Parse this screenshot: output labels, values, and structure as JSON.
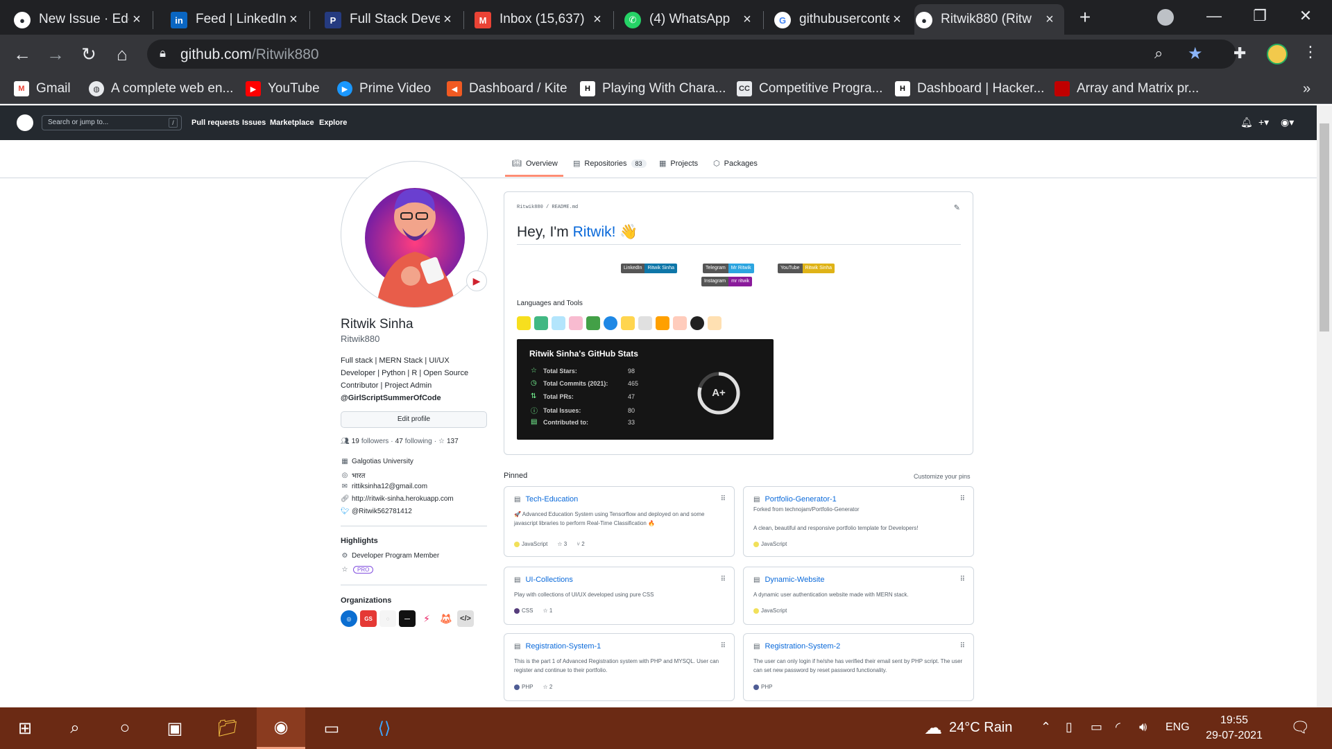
{
  "browser": {
    "tabs": [
      {
        "title": "New Issue · Edc",
        "icon": "github-icon",
        "active": false
      },
      {
        "title": "Feed | LinkedIn",
        "icon": "linkedin-icon",
        "active": false
      },
      {
        "title": "Full Stack Deve",
        "icon": "paypal-icon",
        "active": false
      },
      {
        "title": "Inbox (15,637)",
        "icon": "gmail-icon",
        "active": false
      },
      {
        "title": "(4) WhatsApp",
        "icon": "whatsapp-icon",
        "active": false
      },
      {
        "title": "githubuserconte",
        "icon": "google-icon",
        "active": false
      },
      {
        "title": "Ritwik880 (Ritw",
        "icon": "github-icon",
        "active": true
      }
    ],
    "url_host": "github.com",
    "url_path": "/Ritwik880",
    "bookmarks": [
      {
        "label": "Gmail",
        "icon": "gmail-icon",
        "color": "#ea4335"
      },
      {
        "label": "A complete web en...",
        "icon": "globe-icon",
        "color": "#e8eaed"
      },
      {
        "label": "YouTube",
        "icon": "youtube-icon",
        "color": "#ff0000"
      },
      {
        "label": "Prime Video",
        "icon": "prime-video-icon",
        "color": "#1a98ff"
      },
      {
        "label": "Dashboard / Kite",
        "icon": "kite-icon",
        "color": "#f15a22"
      },
      {
        "label": "Playing With Chara...",
        "icon": "hackerrank-icon",
        "color": "#1ba94c"
      },
      {
        "label": "Competitive Progra...",
        "icon": "codechef-icon",
        "color": "#8a6d3b"
      },
      {
        "label": "Dashboard | Hacker...",
        "icon": "hackerrank-icon",
        "color": "#1ba94c"
      },
      {
        "label": "Array and Matrix pr...",
        "icon": "bookmark-icon",
        "color": "#c00000"
      }
    ]
  },
  "github": {
    "search_placeholder": "Search or jump to...",
    "search_key": "/",
    "nav": [
      "Pull requests",
      "Issues",
      "Marketplace",
      "Explore"
    ],
    "profile_tabs": [
      {
        "label": "Overview",
        "icon": "book-icon"
      },
      {
        "label": "Repositories",
        "icon": "repo-icon",
        "count": "83"
      },
      {
        "label": "Projects",
        "icon": "project-icon"
      },
      {
        "label": "Packages",
        "icon": "package-icon"
      }
    ],
    "profile": {
      "name": "Ritwik Sinha",
      "login": "Ritwik880",
      "bio_lines": [
        "Full stack | MERN Stack | UI/UX",
        "Developer | Python | R | Open Source",
        "Contributor | Project Admin",
        "@GirlScriptSummerOfCode"
      ],
      "edit_label": "Edit profile",
      "followers": "19",
      "followers_label": "followers",
      "following": "47",
      "following_label": "following",
      "stars": "137",
      "vcard": [
        {
          "icon": "organization-icon",
          "text": "Galgotias University"
        },
        {
          "icon": "location-icon",
          "text": "भारत"
        },
        {
          "icon": "mail-icon",
          "text": "rittiksinha12@gmail.com"
        },
        {
          "icon": "link-icon",
          "text": "http://ritwik-sinha.herokuapp.com"
        },
        {
          "icon": "twitter-icon",
          "text": "@Ritwik562781412"
        }
      ],
      "highlights_title": "Highlights",
      "highlight_item": "Developer Program Member",
      "pro_badge": "PRO",
      "organizations_title": "Organizations"
    },
    "readme": {
      "path": "Ritwik880 / README.md",
      "title_prefix": "Hey, I'm ",
      "title_name": "Ritwik!",
      "title_emoji": "👋",
      "badges": [
        {
          "left": "LinkedIn",
          "right": "Ritwik Sinha",
          "left_color": "#555555",
          "right_color": "#0e76a8"
        },
        {
          "left": "Telegram",
          "right": "Mr Ritwik",
          "left_color": "#555555",
          "right_color": "#2ca5e0"
        },
        {
          "left": "YouTube",
          "right": "Ritwik Sinha",
          "left_color": "#555555",
          "right_color": "#dfb317"
        },
        {
          "left": "Instagram",
          "right": "mr ritwik",
          "left_color": "#555555",
          "right_color": "#8a1a9b"
        }
      ],
      "languages_label": "Languages and Tools",
      "stats": {
        "title": "Ritwik Sinha's GitHub Stats",
        "rows": [
          {
            "label": "Total Stars:",
            "value": "98"
          },
          {
            "label": "Total Commits (2021):",
            "value": "465"
          },
          {
            "label": "Total PRs:",
            "value": "47"
          },
          {
            "label": "Total Issues:",
            "value": "80"
          },
          {
            "label": "Contributed to:",
            "value": "33"
          }
        ],
        "grade": "A+"
      }
    },
    "pinned_label": "Pinned",
    "customize_label": "Customize your pins",
    "pinned": [
      {
        "name": "Tech-Education",
        "fork": "",
        "desc": "🚀 Advanced Education System using Tensorflow and deployed on and some javascript libraries to perform Real-Time Classification 🔥",
        "lang": "JavaScript",
        "lang_color": "#f1e05a",
        "stars": "3",
        "forks": "2"
      },
      {
        "name": "Portfolio-Generator-1",
        "fork": "Forked from technojam/Portfolio-Generator",
        "desc": "A clean, beautiful and responsive portfolio template for Developers!",
        "lang": "JavaScript",
        "lang_color": "#f1e05a",
        "stars": "",
        "forks": ""
      },
      {
        "name": "UI-Collections",
        "fork": "",
        "desc": "Play with collections of UI/UX developed using pure CSS",
        "lang": "CSS",
        "lang_color": "#563d7c",
        "stars": "1",
        "forks": ""
      },
      {
        "name": "Dynamic-Website",
        "fork": "",
        "desc": "A dynamic user authentication website made with MERN stack.",
        "lang": "JavaScript",
        "lang_color": "#f1e05a",
        "stars": "",
        "forks": ""
      },
      {
        "name": "Registration-System-1",
        "fork": "",
        "desc": "This is the part 1 of Advanced Registration system with PHP and MYSQL. User can register and continue to their portfolio.",
        "lang": "PHP",
        "lang_color": "#4F5D95",
        "stars": "2",
        "forks": ""
      },
      {
        "name": "Registration-System-2",
        "fork": "",
        "desc": "The user can only login if he/she has verified their email sent by PHP script. The user can set new password by reset password functionality.",
        "lang": "PHP",
        "lang_color": "#4F5D95",
        "stars": "",
        "forks": ""
      }
    ]
  },
  "taskbar": {
    "weather": "24°C  Rain",
    "language": "ENG",
    "time": "19:55",
    "date": "29-07-2021"
  },
  "colors": {
    "chrome_dark": "#202124",
    "chrome_toolbar": "#35363a",
    "github_header": "#24292f",
    "link_blue": "#0969da",
    "taskbar": "#6b2a14"
  }
}
